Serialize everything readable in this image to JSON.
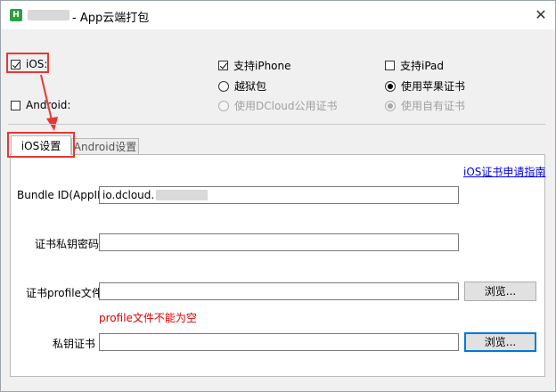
{
  "window": {
    "title": "- App云端打包",
    "app_icon_letter": "H",
    "close_glyph": "✕"
  },
  "platforms": {
    "ios": {
      "label": "iOS:",
      "checked": true
    },
    "android": {
      "label": "Android:",
      "checked": false
    }
  },
  "ios_options": {
    "support_iphone": {
      "label": "支持iPhone",
      "checked": true
    },
    "support_ipad": {
      "label": "支持iPad",
      "checked": false
    },
    "jailbreak": {
      "label": "越狱包",
      "selected": false
    },
    "apple_cert": {
      "label": "使用苹果证书",
      "selected": true
    },
    "dcloud_cert": {
      "label": "使用DCloud公用证书",
      "selected": false,
      "disabled": true
    },
    "own_cert": {
      "label": "使用自有证书",
      "selected": true,
      "disabled": true
    }
  },
  "tabs": {
    "ios": "iOS设置",
    "android": "Android设置"
  },
  "ios_settings": {
    "cert_guide_link": "iOS证书申请指南",
    "bundle_id_label": "Bundle ID(AppID)",
    "bundle_id_value": "io.dcloud.",
    "cert_password_label": "证书私钥密码",
    "cert_password_value": "",
    "profile_label": "证书profile文件",
    "profile_value": "",
    "profile_error": "profile文件不能为空",
    "private_key_label": "私钥证书",
    "private_key_value": "",
    "browse_label": "浏览..."
  },
  "colors": {
    "annotation_red": "#e53935",
    "error_red": "#e00000",
    "link_blue": "#0000ee",
    "focus_blue": "#0078d7"
  }
}
